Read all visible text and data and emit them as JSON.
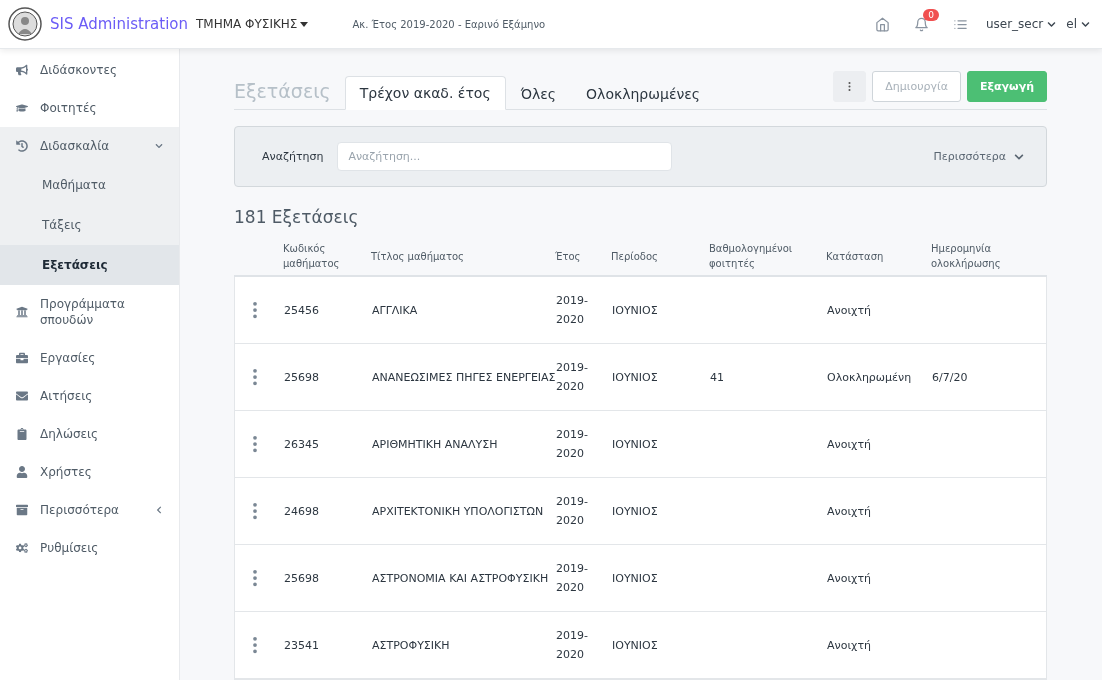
{
  "header": {
    "app_name": "SIS Administration",
    "department": "ΤΜΗΜΑ ΦΥΣΙΚΗΣ",
    "period": "Ακ. Έτος 2019-2020 - Εαρινό Εξάμηνο",
    "notifications": "0",
    "user": "user_secr",
    "language": "el"
  },
  "sidebar": {
    "items": [
      {
        "label": "Διδάσκοντες",
        "selected": false
      },
      {
        "label": "Φοιτητές",
        "selected": false
      },
      {
        "label": "Διδασκαλία",
        "selected": false,
        "expanded": true,
        "children": [
          {
            "label": "Μαθήματα",
            "selected": false
          },
          {
            "label": "Τάξεις",
            "selected": false
          },
          {
            "label": "Εξετάσεις",
            "selected": true
          }
        ]
      },
      {
        "label": "Προγράμματα σπουδών",
        "selected": false
      },
      {
        "label": "Εργασίες",
        "selected": false
      },
      {
        "label": "Αιτήσεις",
        "selected": false
      },
      {
        "label": "Δηλώσεις",
        "selected": false
      },
      {
        "label": "Χρήστες",
        "selected": false
      },
      {
        "label": "Περισσότερα",
        "selected": false,
        "expanded": false
      },
      {
        "label": "Ρυθμίσεις",
        "selected": false
      }
    ]
  },
  "page": {
    "title": "Εξετάσεις",
    "tabs": [
      {
        "label": "Τρέχον ακαδ. έτος",
        "selected": true
      },
      {
        "label": "Όλες",
        "selected": false
      },
      {
        "label": "Ολοκληρωμένες",
        "selected": false
      }
    ],
    "actions": [
      {
        "kind": "menu"
      },
      {
        "kind": "secondary",
        "label": "Δημιουργία",
        "disabled": true
      },
      {
        "kind": "primary",
        "label": "Εξαγωγή",
        "disabled": false
      }
    ]
  },
  "search": {
    "label": "Αναζήτηση",
    "placeholder": "Αναζήτηση...",
    "more": "Περισσότερα"
  },
  "table": {
    "count": "181 Εξετάσεις",
    "columns": [
      "Κωδικός μαθήματος",
      "Τίτλος μαθήματος",
      "Έτος",
      "Περίοδος",
      "Βαθμολογημένοι φοιτητές",
      "Κατάσταση",
      "Ημερομηνία ολοκλήρωσης"
    ],
    "rows": [
      [
        "25456",
        "ΑΓΓΛΙΚΑ",
        "2019-2020",
        "ΙΟΥΝΙΟΣ",
        "",
        "Ανοιχτή",
        ""
      ],
      [
        "25698",
        "ΑΝΑΝΕΩΣΙΜΕΣ ΠΗΓΕΣ ΕΝΕΡΓΕΙΑΣ",
        "2019-2020",
        "ΙΟΥΝΙΟΣ",
        "41",
        "Ολοκληρωμένη",
        "6/7/20"
      ],
      [
        "26345",
        "ΑΡΙΘΜΗΤΙΚΗ ΑΝΑΛΥΣΗ",
        "2019-2020",
        "ΙΟΥΝΙΟΣ",
        "",
        "Ανοιχτή",
        ""
      ],
      [
        "24698",
        "ΑΡΧΙΤΕΚΤΟΝΙΚΗ ΥΠΟΛΟΓΙΣΤΩΝ",
        "2019-2020",
        "ΙΟΥΝΙΟΣ",
        "",
        "Ανοιχτή",
        ""
      ],
      [
        "25698",
        "ΑΣΤΡΟΝΟΜΙΑ ΚΑΙ ΑΣΤΡΟΦΥΣΙΚΗ",
        "2019-2020",
        "ΙΟΥΝΙΟΣ",
        "",
        "Ανοιχτή",
        ""
      ],
      [
        "23541",
        "ΑΣΤΡΟΦΥΣΙΚΗ",
        "2019-2020",
        "ΙΟΥΝΙΟΣ",
        "",
        "Ανοιχτή",
        ""
      ]
    ]
  }
}
